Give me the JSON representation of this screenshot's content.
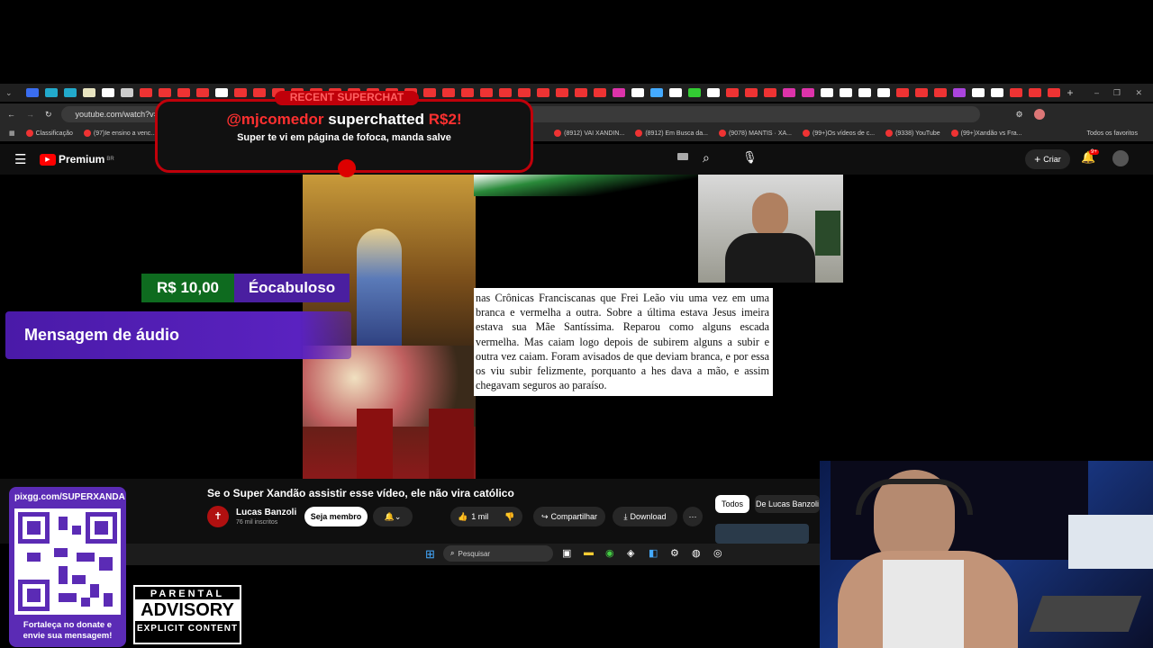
{
  "browser": {
    "url": "youtube.com/watch?v=",
    "bookmarks": [
      "Classificação",
      "(97)Ie ensino a venc...",
      "(8912) VAI XANDIN...",
      "(8912) Em Busca da...",
      "(9078) MANTIS · XA...",
      "(99+)Os vídeos de c...",
      "(9338) YouTube",
      "(99+)Xandão vs Fra..."
    ],
    "all_bookmarks": "Todos os favoritos"
  },
  "youtube": {
    "logo": "Premium",
    "region": "BR",
    "create_label": "Criar",
    "notif_count": "9+"
  },
  "superchat": {
    "header": "RECENT SUPERCHAT",
    "user": "@mjcomedor",
    "action": "superchatted",
    "amount": "R$2!",
    "message": "Super te vi em página de fofoca, manda salve"
  },
  "donation": {
    "amount": "R$ 10,00",
    "name": "Éocabuloso",
    "audio_label": "Mensagem de áudio"
  },
  "video_text": "nas Crônicas Franciscanas que Frei Leão viu uma vez em uma branca e vermelha a outra. Sobre a última estava Jesus imeira estava sua Mãe Santíssima. Reparou como alguns escada vermelha. Mas caiam logo depois de subirem alguns a subir e outra vez caiam. Foram avisados de que deviam branca, e por essa os viu subir felizmente, porquanto a hes dava a mão, e assim chegavam seguros ao paraíso.",
  "video_info": {
    "title": "Se o Super Xandão assistir esse vídeo, ele não vira católico",
    "channel": "Lucas Banzoli",
    "subs": "76 mil inscritos",
    "join": "Seja membro",
    "likes": "1 mil",
    "share": "Compartilhar",
    "download": "Download",
    "chip_all": "Todos",
    "chip_channel": "De Lucas Banzoli"
  },
  "taskbar": {
    "search": "Pesquisar"
  },
  "qr": {
    "url": "pixgg.com/SUPERXANDA",
    "caption": "Fortaleça no donate e envie sua mensagem!"
  },
  "advisory": {
    "line1": "PARENTAL",
    "line2": "ADVISORY",
    "line3": "EXPLICIT CONTENT"
  },
  "colors": {
    "superchat_red": "#c0000a",
    "donation_green": "#0e6b1f",
    "donation_purple": "#4a1fa0"
  }
}
